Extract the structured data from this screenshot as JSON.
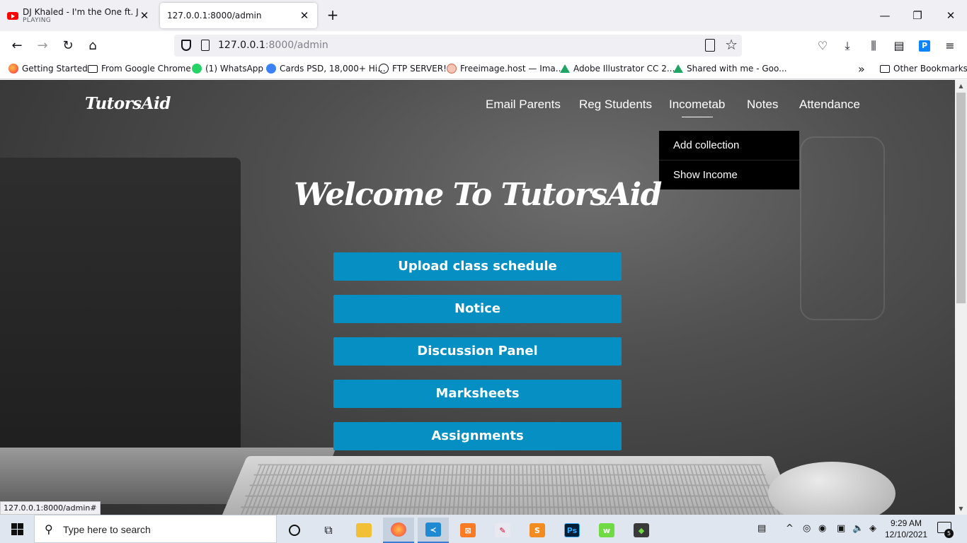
{
  "browser": {
    "tabs": [
      {
        "title": "DJ Khaled - I'm the One ft. Justi",
        "subtitle": "PLAYING",
        "icon": "youtube-icon"
      },
      {
        "title": "127.0.0.1:8000/admin"
      }
    ],
    "url_host": "127.0.0.1",
    "url_rest": ":8000/admin",
    "bookmarks": [
      {
        "label": "Getting Started",
        "icon": "firefox-icon"
      },
      {
        "label": "From Google Chrome",
        "icon": "folder-icon"
      },
      {
        "label": "(1) WhatsApp",
        "icon": "whatsapp-icon"
      },
      {
        "label": "Cards PSD, 18,000+ Hi...",
        "icon": "card-icon"
      },
      {
        "label": "FTP SERVER!",
        "icon": "globe-icon"
      },
      {
        "label": "Freeimage.host — Ima...",
        "icon": "freeimage-icon"
      },
      {
        "label": "Adobe Illustrator CC 2...",
        "icon": "google-drive-icon"
      },
      {
        "label": "Shared with me - Goo...",
        "icon": "google-drive-icon"
      }
    ],
    "other_bookmarks": "Other Bookmarks",
    "status_url": "127.0.0.1:8000/admin#"
  },
  "site": {
    "brand": "TutorsAid",
    "nav": [
      "Email Parents",
      "Reg Students",
      "Incometab",
      "Notes",
      "Attendance"
    ],
    "active_nav": "Incometab",
    "dropdown": [
      "Add collection",
      "Show Income"
    ],
    "welcome": "Welcome To TutorsAid",
    "actions": [
      "Upload class schedule",
      "Notice",
      "Discussion Panel",
      "Marksheets",
      "Assignments"
    ],
    "button_color": "#068fc2"
  },
  "taskbar": {
    "search_placeholder": "Type here to search",
    "time": "9:29 AM",
    "date": "12/10/2021",
    "notification_count": "5"
  }
}
